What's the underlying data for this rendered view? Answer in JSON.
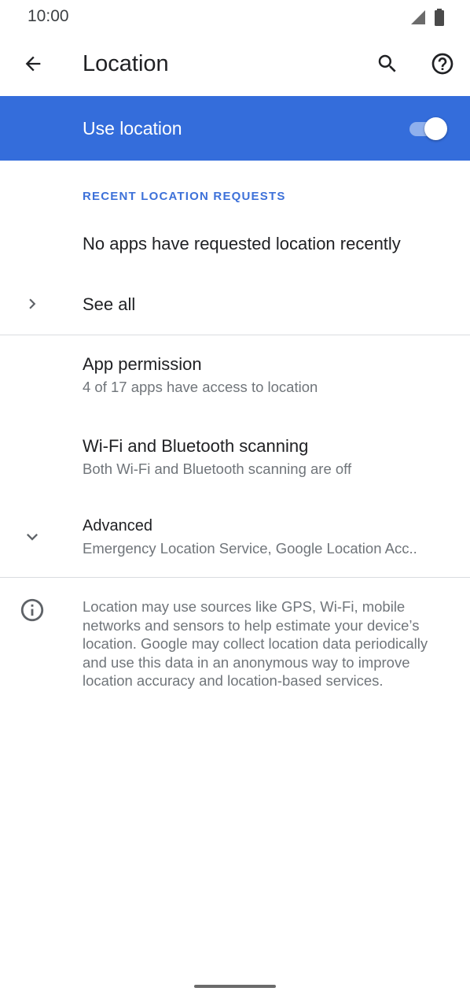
{
  "status_bar": {
    "time": "10:00",
    "icons": [
      "signal-icon",
      "battery-icon"
    ]
  },
  "app_bar": {
    "title": "Location",
    "icons": [
      "back-arrow-icon",
      "search-icon",
      "help-icon"
    ]
  },
  "master_switch": {
    "label": "Use location",
    "enabled": true,
    "accent_color": "#346ddb"
  },
  "recent_requests": {
    "header": "RECENT LOCATION REQUESTS",
    "empty_message": "No apps have requested location recently",
    "see_all_label": "See all"
  },
  "settings": [
    {
      "title": "App permission",
      "summary": "4 of 17 apps have access to location"
    },
    {
      "title": "Wi-Fi and Bluetooth scanning",
      "summary": "Both Wi-Fi and Bluetooth scanning are off"
    },
    {
      "title": "Advanced",
      "summary": "Emergency Location Service, Google Location Acc.."
    }
  ],
  "footer": {
    "text": "Location may use sources like GPS, Wi-Fi, mobile networks and sensors to help estimate your device’s location. Google may collect location data periodically and use this data in an anonymous way to improve location accuracy and location-based services."
  }
}
